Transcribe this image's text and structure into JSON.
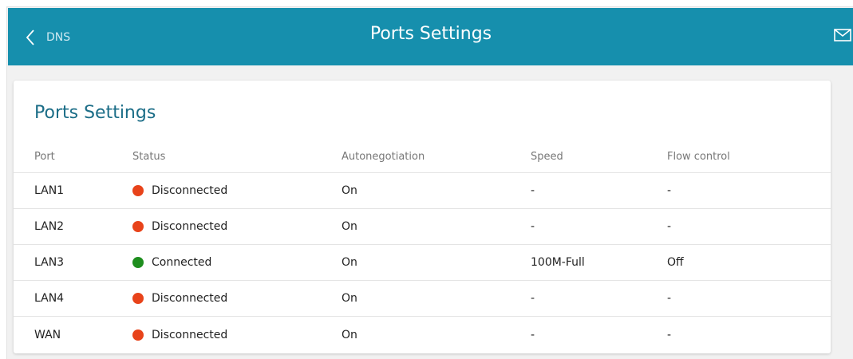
{
  "header": {
    "back_label": "DNS",
    "title": "Ports Settings",
    "back_icon": "chevron-left-icon",
    "mail_icon": "envelope-icon",
    "color": "#168fad"
  },
  "card": {
    "title": "Ports Settings"
  },
  "table": {
    "columns": [
      "Port",
      "Status",
      "Autonegotiation",
      "Speed",
      "Flow control"
    ],
    "rows": [
      {
        "port": "LAN1",
        "status": "Disconnected",
        "state": "disconnected",
        "autonegotiation": "On",
        "speed": "-",
        "flow_control": "-"
      },
      {
        "port": "LAN2",
        "status": "Disconnected",
        "state": "disconnected",
        "autonegotiation": "On",
        "speed": "-",
        "flow_control": "-"
      },
      {
        "port": "LAN3",
        "status": "Connected",
        "state": "connected",
        "autonegotiation": "On",
        "speed": "100M-Full",
        "flow_control": "Off"
      },
      {
        "port": "LAN4",
        "status": "Disconnected",
        "state": "disconnected",
        "autonegotiation": "On",
        "speed": "-",
        "flow_control": "-"
      },
      {
        "port": "WAN",
        "status": "Disconnected",
        "state": "disconnected",
        "autonegotiation": "On",
        "speed": "-",
        "flow_control": "-"
      }
    ]
  },
  "colors": {
    "accent": "#168fad",
    "title_text": "#1b6d87",
    "connected": "#1e8e1e",
    "disconnected": "#e8431a"
  }
}
